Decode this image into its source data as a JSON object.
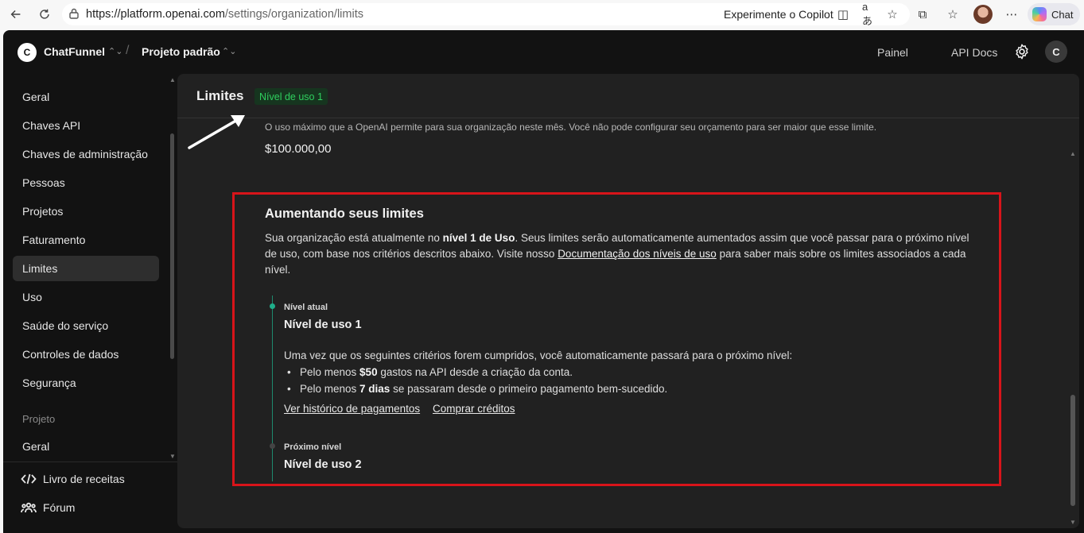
{
  "browser": {
    "url_host": "https://platform.openai.com",
    "url_path": "/settings/organization/limits",
    "copilot_label": "Experimente o Copilot",
    "chat_label": "Chat",
    "icons": [
      "back-icon",
      "refresh-icon",
      "lock-icon",
      "copilot-icon",
      "translate-icon",
      "star-icon",
      "extensions-icon",
      "favorites-icon",
      "more-icon"
    ]
  },
  "topbar": {
    "org_initial": "C",
    "org_name": "ChatFunnel",
    "separator": "/",
    "project_name": "Projeto padrão",
    "links": [
      "Painel",
      "API Docs"
    ],
    "user_initial": "C"
  },
  "sidebar": {
    "items": [
      {
        "label": "Geral"
      },
      {
        "label": "Chaves API"
      },
      {
        "label": "Chaves de administração"
      },
      {
        "label": "Pessoas"
      },
      {
        "label": "Projetos"
      },
      {
        "label": "Faturamento"
      },
      {
        "label": "Limites",
        "active": true
      },
      {
        "label": "Uso"
      },
      {
        "label": "Saúde do serviço"
      },
      {
        "label": "Controles de dados"
      },
      {
        "label": "Segurança"
      }
    ],
    "section_label": "Projeto",
    "project_items": [
      {
        "label": "Geral"
      }
    ],
    "footer": [
      {
        "label": "Livro de receitas",
        "icon": "code-icon"
      },
      {
        "label": "Fórum",
        "icon": "people-icon"
      }
    ]
  },
  "main": {
    "title": "Limites",
    "badge": "Nível de uso 1",
    "description": "O uso máximo que a OpenAI permite para sua organização neste mês. Você não pode configurar seu orçamento para ser maior que esse limite.",
    "amount": "$100.000,00",
    "card": {
      "title": "Aumentando seus limites",
      "body_1": "Sua organização está atualmente no ",
      "body_bold": "nível 1 de Uso",
      "body_2": ". Seus limites serão automaticamente aumentados assim que você passar para o próximo nível de uso, com base nos critérios descritos abaixo. Visite nosso ",
      "body_link": "Documentação dos níveis de uso",
      "body_3": " para saber mais sobre os limites associados a cada nível.",
      "current_label": "Nível atual",
      "current_title": "Nível de uso 1",
      "criteria_intro": "Uma vez que os seguintes critérios forem cumpridos, você automaticamente passará para o próximo nível:",
      "criteria": [
        {
          "pre": "Pelo menos ",
          "bold": "$50",
          "post": " gastos na API desde a criação da conta."
        },
        {
          "pre": "Pelo menos ",
          "bold": "7 dias",
          "post": " se passaram desde o primeiro pagamento bem-sucedido."
        }
      ],
      "link_history": "Ver histórico de pagamentos",
      "link_buy": "Comprar créditos",
      "next_label": "Próximo nível",
      "next_title": "Nível de uso 2"
    }
  },
  "colors": {
    "badge_text": "#2fcf5e",
    "highlight_box": "#d8141a",
    "timeline_active": "#1fae8a"
  }
}
